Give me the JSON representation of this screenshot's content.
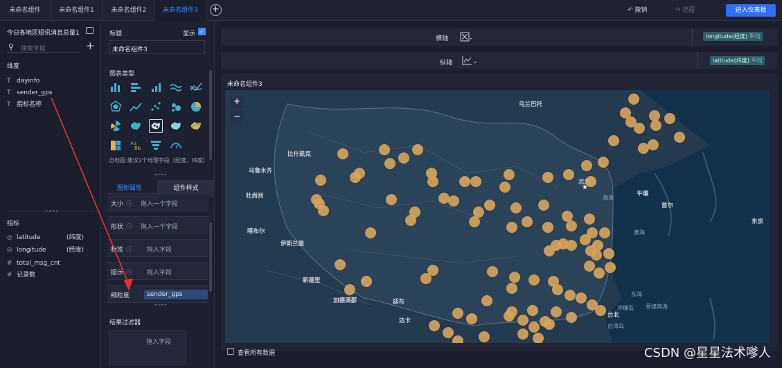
{
  "tabs": [
    {
      "label": "未命名组件"
    },
    {
      "label": "未命名组件1"
    },
    {
      "label": "未命名组件2"
    },
    {
      "label": "未命名组件3"
    }
  ],
  "toolbar": {
    "undo": "撤销",
    "redo": "还原",
    "enter": "进入仪表板"
  },
  "left": {
    "dataset": "今日各地区短讯消息总量1",
    "search_placeholder": "搜索字段",
    "dimension_title": "维度",
    "dimensions": [
      {
        "icon": "T",
        "label": "dayinfo"
      },
      {
        "icon": "T",
        "label": "sender_gps"
      },
      {
        "icon": "T",
        "label": "指标名称"
      }
    ],
    "measure_title": "指标",
    "measures": [
      {
        "icon": "globe",
        "label": "latitude",
        "tag": "(纬度)"
      },
      {
        "icon": "globe",
        "label": "longitude",
        "tag": "(经度)"
      },
      {
        "icon": "#",
        "label": "total_msg_cnt",
        "tag": ""
      },
      {
        "icon": "#",
        "label": "记录数",
        "tag": ""
      }
    ]
  },
  "mid": {
    "title_label": "标题",
    "show_label": "显示",
    "title_value": "未命名组件3",
    "chart_type_label": "图表类型",
    "chart_hint": "点地图:建议2个地理字段（经度、纬度）",
    "tabs": [
      "图形属性",
      "组件样式"
    ],
    "rows": [
      {
        "key": "大小",
        "value": "拖入一个字段"
      },
      {
        "key": "形状",
        "value": "拖入一个字段"
      },
      {
        "key": "标签",
        "value": "拖入字段"
      },
      {
        "key": "提示",
        "value": "拖入字段"
      },
      {
        "key": "细粒度",
        "value": "sender_gps"
      }
    ],
    "filter_title": "结果过滤器",
    "filter_drop": "拖入字段"
  },
  "right": {
    "x_axis_label": "横轴",
    "x_pill": "longitude(经度)",
    "x_pill_sub": "平均",
    "y_axis_label": "纵轴",
    "y_pill": "latitude(纬度)",
    "y_pill_sub": "平均",
    "component_title": "未命名组件3",
    "zoom_in": "+",
    "zoom_out": "−",
    "view_all": "查看所有数据",
    "cities": [
      "乌兰巴托",
      "比什凯克",
      "乌鲁木齐",
      "杜尚别",
      "喀布尔",
      "伊斯兰堡",
      "新德里",
      "加德满都",
      "廷布",
      "达卡",
      "北京",
      "渤海",
      "平壤",
      "首尔",
      "东京",
      "黄海",
      "东海",
      "台北",
      "冲绳岛",
      "台湾岛",
      "菲律宾海"
    ],
    "watermark": "CSDN @星星法术嗲人"
  }
}
